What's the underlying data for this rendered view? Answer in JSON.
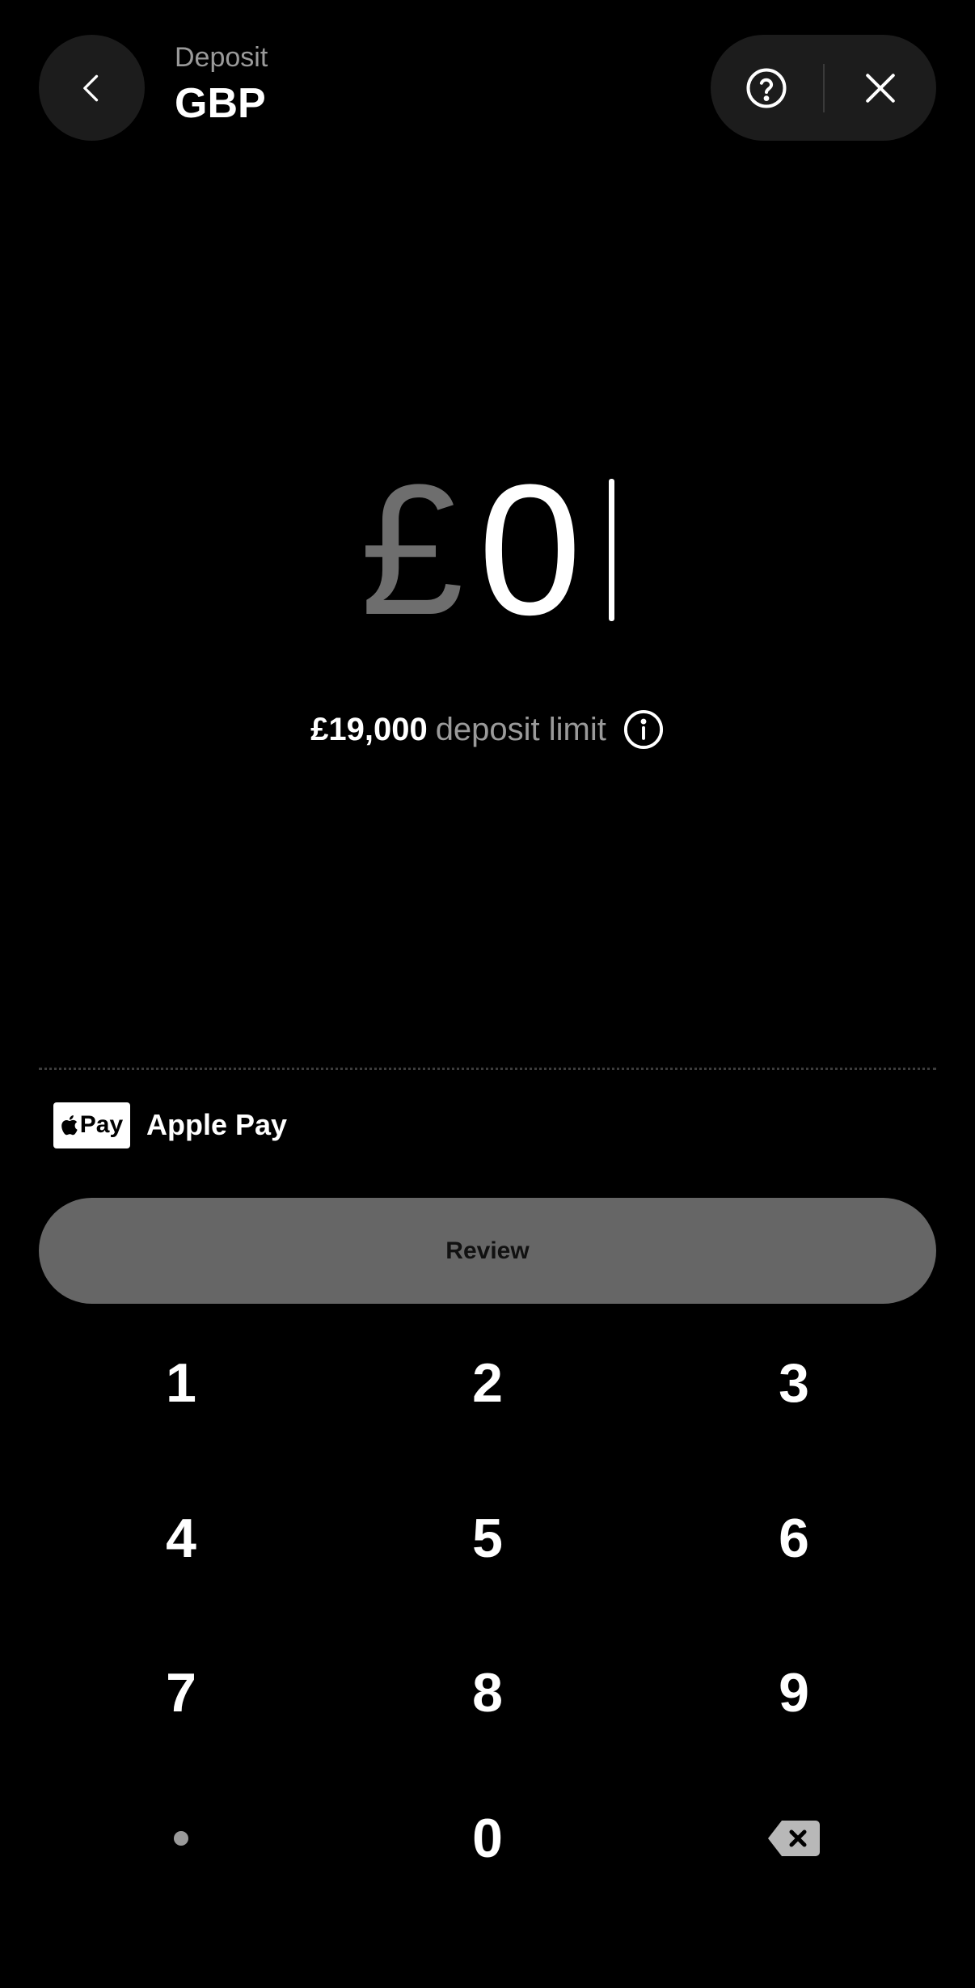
{
  "header": {
    "subtitle": "Deposit",
    "title": "GBP"
  },
  "amount": {
    "currency": "£",
    "value": "0"
  },
  "limit": {
    "amount": "£19,000",
    "text": "deposit limit"
  },
  "payment_method": {
    "badge": "Pay",
    "label": "Apple Pay"
  },
  "review_button": {
    "label": "Review"
  },
  "keypad": {
    "keys": [
      "1",
      "2",
      "3",
      "4",
      "5",
      "6",
      "7",
      "8",
      "9",
      "0"
    ]
  },
  "colors": {
    "background": "#000000",
    "surface": "#1c1c1c",
    "muted_text": "#9a9a9a",
    "disabled_button": "#666666"
  },
  "icons": {
    "back": "chevron-left-icon",
    "help": "question-circle-icon",
    "close": "close-icon",
    "info": "info-circle-icon",
    "backspace": "backspace-icon",
    "apple": "apple-logo-icon"
  }
}
